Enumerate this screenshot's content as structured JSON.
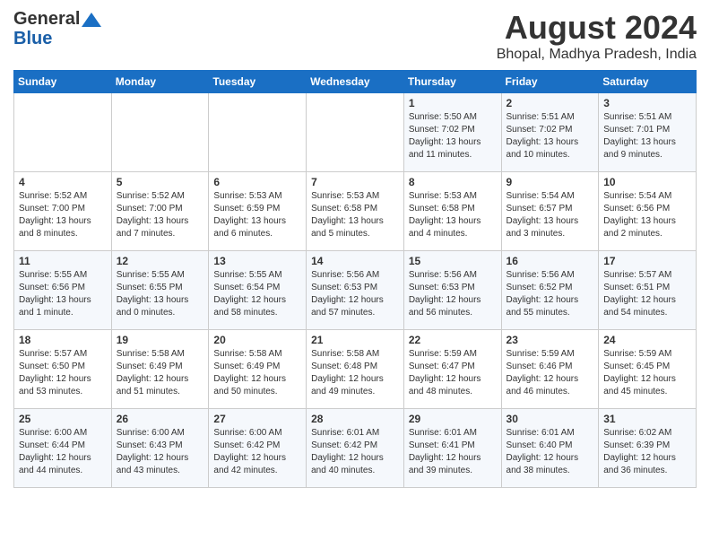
{
  "logo": {
    "general": "General",
    "blue": "Blue"
  },
  "title": "August 2024",
  "location": "Bhopal, Madhya Pradesh, India",
  "days_of_week": [
    "Sunday",
    "Monday",
    "Tuesday",
    "Wednesday",
    "Thursday",
    "Friday",
    "Saturday"
  ],
  "weeks": [
    [
      {
        "day": "",
        "info": ""
      },
      {
        "day": "",
        "info": ""
      },
      {
        "day": "",
        "info": ""
      },
      {
        "day": "",
        "info": ""
      },
      {
        "day": "1",
        "info": "Sunrise: 5:50 AM\nSunset: 7:02 PM\nDaylight: 13 hours and 11 minutes."
      },
      {
        "day": "2",
        "info": "Sunrise: 5:51 AM\nSunset: 7:02 PM\nDaylight: 13 hours and 10 minutes."
      },
      {
        "day": "3",
        "info": "Sunrise: 5:51 AM\nSunset: 7:01 PM\nDaylight: 13 hours and 9 minutes."
      }
    ],
    [
      {
        "day": "4",
        "info": "Sunrise: 5:52 AM\nSunset: 7:00 PM\nDaylight: 13 hours and 8 minutes."
      },
      {
        "day": "5",
        "info": "Sunrise: 5:52 AM\nSunset: 7:00 PM\nDaylight: 13 hours and 7 minutes."
      },
      {
        "day": "6",
        "info": "Sunrise: 5:53 AM\nSunset: 6:59 PM\nDaylight: 13 hours and 6 minutes."
      },
      {
        "day": "7",
        "info": "Sunrise: 5:53 AM\nSunset: 6:58 PM\nDaylight: 13 hours and 5 minutes."
      },
      {
        "day": "8",
        "info": "Sunrise: 5:53 AM\nSunset: 6:58 PM\nDaylight: 13 hours and 4 minutes."
      },
      {
        "day": "9",
        "info": "Sunrise: 5:54 AM\nSunset: 6:57 PM\nDaylight: 13 hours and 3 minutes."
      },
      {
        "day": "10",
        "info": "Sunrise: 5:54 AM\nSunset: 6:56 PM\nDaylight: 13 hours and 2 minutes."
      }
    ],
    [
      {
        "day": "11",
        "info": "Sunrise: 5:55 AM\nSunset: 6:56 PM\nDaylight: 13 hours and 1 minute."
      },
      {
        "day": "12",
        "info": "Sunrise: 5:55 AM\nSunset: 6:55 PM\nDaylight: 13 hours and 0 minutes."
      },
      {
        "day": "13",
        "info": "Sunrise: 5:55 AM\nSunset: 6:54 PM\nDaylight: 12 hours and 58 minutes."
      },
      {
        "day": "14",
        "info": "Sunrise: 5:56 AM\nSunset: 6:53 PM\nDaylight: 12 hours and 57 minutes."
      },
      {
        "day": "15",
        "info": "Sunrise: 5:56 AM\nSunset: 6:53 PM\nDaylight: 12 hours and 56 minutes."
      },
      {
        "day": "16",
        "info": "Sunrise: 5:56 AM\nSunset: 6:52 PM\nDaylight: 12 hours and 55 minutes."
      },
      {
        "day": "17",
        "info": "Sunrise: 5:57 AM\nSunset: 6:51 PM\nDaylight: 12 hours and 54 minutes."
      }
    ],
    [
      {
        "day": "18",
        "info": "Sunrise: 5:57 AM\nSunset: 6:50 PM\nDaylight: 12 hours and 53 minutes."
      },
      {
        "day": "19",
        "info": "Sunrise: 5:58 AM\nSunset: 6:49 PM\nDaylight: 12 hours and 51 minutes."
      },
      {
        "day": "20",
        "info": "Sunrise: 5:58 AM\nSunset: 6:49 PM\nDaylight: 12 hours and 50 minutes."
      },
      {
        "day": "21",
        "info": "Sunrise: 5:58 AM\nSunset: 6:48 PM\nDaylight: 12 hours and 49 minutes."
      },
      {
        "day": "22",
        "info": "Sunrise: 5:59 AM\nSunset: 6:47 PM\nDaylight: 12 hours and 48 minutes."
      },
      {
        "day": "23",
        "info": "Sunrise: 5:59 AM\nSunset: 6:46 PM\nDaylight: 12 hours and 46 minutes."
      },
      {
        "day": "24",
        "info": "Sunrise: 5:59 AM\nSunset: 6:45 PM\nDaylight: 12 hours and 45 minutes."
      }
    ],
    [
      {
        "day": "25",
        "info": "Sunrise: 6:00 AM\nSunset: 6:44 PM\nDaylight: 12 hours and 44 minutes."
      },
      {
        "day": "26",
        "info": "Sunrise: 6:00 AM\nSunset: 6:43 PM\nDaylight: 12 hours and 43 minutes."
      },
      {
        "day": "27",
        "info": "Sunrise: 6:00 AM\nSunset: 6:42 PM\nDaylight: 12 hours and 42 minutes."
      },
      {
        "day": "28",
        "info": "Sunrise: 6:01 AM\nSunset: 6:42 PM\nDaylight: 12 hours and 40 minutes."
      },
      {
        "day": "29",
        "info": "Sunrise: 6:01 AM\nSunset: 6:41 PM\nDaylight: 12 hours and 39 minutes."
      },
      {
        "day": "30",
        "info": "Sunrise: 6:01 AM\nSunset: 6:40 PM\nDaylight: 12 hours and 38 minutes."
      },
      {
        "day": "31",
        "info": "Sunrise: 6:02 AM\nSunset: 6:39 PM\nDaylight: 12 hours and 36 minutes."
      }
    ]
  ]
}
